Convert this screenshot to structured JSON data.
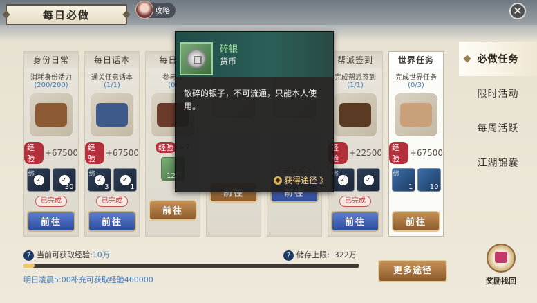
{
  "header": {
    "title": "每日必做",
    "strategy_label": "攻略",
    "close_symbol": "✕"
  },
  "nav": [
    {
      "label": "必做任务",
      "active": true
    },
    {
      "label": "限时活动",
      "active": false
    },
    {
      "label": "每周活跃",
      "active": false
    },
    {
      "label": "江湖锦囊",
      "active": false
    }
  ],
  "cards": [
    {
      "title": "身份日常",
      "desc": "消耗身份活力",
      "progress": "(200/200)",
      "exp": "+67500",
      "items": [
        {
          "badge": "绑",
          "qty": "",
          "check": true
        },
        {
          "badge": "",
          "qty": "30",
          "check": true
        }
      ],
      "done": true,
      "go": "前往",
      "btn": "blue",
      "pic": "#8b5a32"
    },
    {
      "title": "每日话本",
      "desc": "通关任意话本",
      "progress": "(1/1)",
      "exp": "+67500",
      "items": [
        {
          "badge": "绑",
          "qty": "3",
          "check": true
        },
        {
          "badge": "",
          "qty": "1",
          "check": true
        }
      ],
      "done": true,
      "go": "前往",
      "btn": "blue",
      "pic": "#3e5a8a"
    },
    {
      "title": "每日竞",
      "desc": "参与任",
      "progress": "(0/",
      "exp": "+7",
      "items": [
        {
          "badge": "",
          "qty": "12万",
          "check": false,
          "silver": true
        }
      ],
      "done": false,
      "go": "前往",
      "btn": "brown",
      "pic": "#6b3a2a"
    },
    {
      "title": "",
      "desc": "",
      "progress": "",
      "exp": "",
      "items": [],
      "done": false,
      "go": "前往",
      "btn": "brown",
      "pic": ""
    },
    {
      "title": "",
      "desc": "",
      "progress": "",
      "exp": "",
      "items": [],
      "done": true,
      "go": "前往",
      "btn": "blue",
      "pic": ""
    },
    {
      "title": "帮派签到",
      "desc": "完成帮派签到",
      "progress": "(1/1)",
      "exp": "+22500",
      "items": [
        {
          "badge": "绑",
          "qty": "",
          "check": true
        },
        {
          "badge": "",
          "qty": "",
          "check": true
        }
      ],
      "done": true,
      "go": "前往",
      "btn": "blue",
      "pic": "#5a3a22"
    },
    {
      "title": "世界任务",
      "desc": "完成世界任务",
      "progress": "(0/3)",
      "exp": "+67500",
      "items": [
        {
          "badge": "绑",
          "qty": "1",
          "check": false,
          "blue": true
        },
        {
          "badge": "",
          "qty": "10",
          "check": false,
          "blue": true
        }
      ],
      "done": false,
      "go": "前往",
      "btn": "brown",
      "pic": "#c9a07a"
    }
  ],
  "labels": {
    "exp_tag": "经验",
    "done": "已完成"
  },
  "tooltip": {
    "name": "碎银",
    "type": "货币",
    "desc": "散碎的银子，不可流通，只能本人使用。",
    "source": "获得途径",
    "source_arrow": "》"
  },
  "bottom": {
    "exp_label": "当前可获取经验:",
    "exp_value": "10万",
    "store_label": "储存上限:",
    "store_value": "322万",
    "progress": 0.033,
    "tomorrow_prefix": "明日凌晨",
    "tomorrow_time": "5:00",
    "tomorrow_mid": "补充可获取经验",
    "tomorrow_value": "460000"
  },
  "more_button": "更多途径",
  "reward": "奖励找回",
  "colors": {
    "accent_blue": "#3d7bbd",
    "exp_red": "#b3303a",
    "tooltip_green": "#a7e7a2",
    "source_gold": "#f2d48a"
  }
}
